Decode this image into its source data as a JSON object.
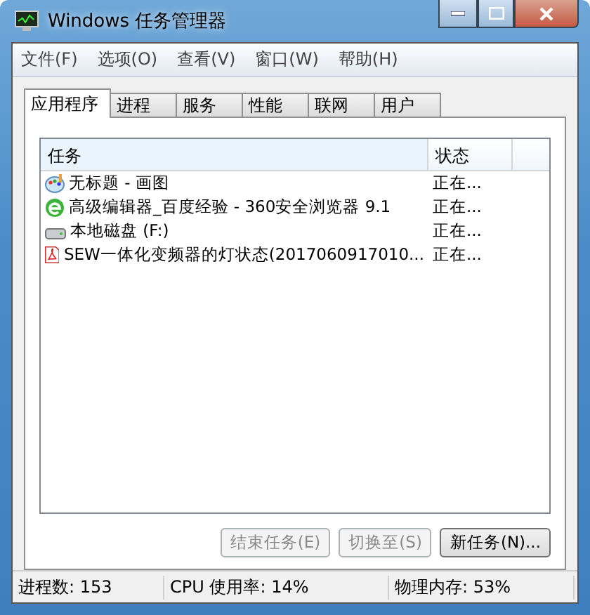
{
  "window": {
    "title": "Windows 任务管理器"
  },
  "menu": [
    "文件(F)",
    "选项(O)",
    "查看(V)",
    "窗口(W)",
    "帮助(H)"
  ],
  "tabs": [
    {
      "label": "应用程序",
      "selected": true
    },
    {
      "label": "进程",
      "selected": false
    },
    {
      "label": "服务",
      "selected": false
    },
    {
      "label": "性能",
      "selected": false
    },
    {
      "label": "联网",
      "selected": false
    },
    {
      "label": "用户",
      "selected": false
    }
  ],
  "table": {
    "columns": [
      "任务",
      "状态"
    ],
    "rows": [
      {
        "kind": "paint",
        "task": "无标题 - 画图",
        "status": "正在..."
      },
      {
        "kind": "browser",
        "task": "高级编辑器_百度经验 - 360安全浏览器 9.1",
        "status": "正在..."
      },
      {
        "kind": "disk",
        "task": "本地磁盘 (F:)",
        "status": "正在..."
      },
      {
        "kind": "pdf",
        "task": "SEW一体化变频器的灯状态(2017060917010...",
        "status": "正在..."
      }
    ]
  },
  "buttons": [
    {
      "label": "结束任务(E)",
      "disabled": true
    },
    {
      "label": "切换至(S)",
      "disabled": true
    },
    {
      "label": "新任务(N)...",
      "disabled": false
    }
  ],
  "status_bar": [
    "进程数: 153",
    "CPU 使用率: 14%",
    "物理内存: 53%"
  ]
}
